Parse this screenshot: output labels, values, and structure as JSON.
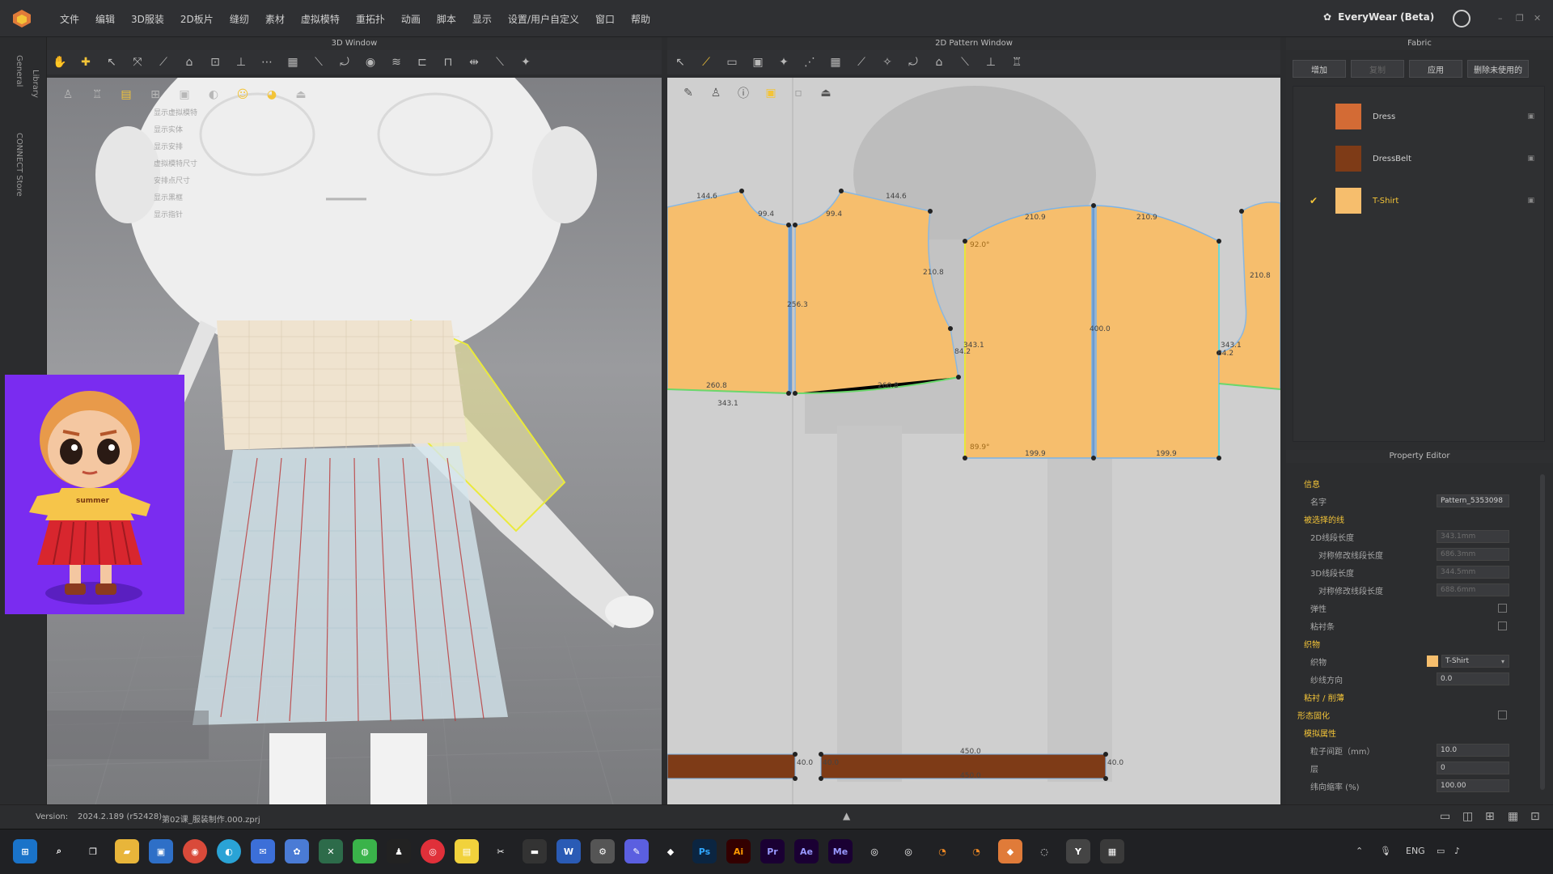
{
  "menu": [
    "文件",
    "编辑",
    "3D服装",
    "2D板片",
    "缝纫",
    "素材",
    "虚拟模特",
    "重拓扑",
    "动画",
    "脚本",
    "显示",
    "设置/用户自定义",
    "窗口",
    "帮助"
  ],
  "brand": "EveryWear (Beta)",
  "left_tabs": [
    "Library",
    "General",
    "CONNECT Store"
  ],
  "windows": {
    "3d_title": "3D Window",
    "2d_title": "2D Pattern Window",
    "fabric_title": "Fabric",
    "property_title": "Property Editor"
  },
  "avatar_menu": [
    "显示虚拟模特",
    "显示实体",
    "显示安排",
    "虚拟模特尺寸",
    "安排点尺寸",
    "显示黑框",
    "显示指针"
  ],
  "preview_shirt_text": "summer",
  "fabric": {
    "buttons": [
      "增加",
      "复制",
      "应用",
      "删除未使用的"
    ],
    "items": [
      {
        "name": "Dress",
        "color": "#d36b35",
        "selected": false
      },
      {
        "name": "DressBelt",
        "color": "#7e3b17",
        "selected": false
      },
      {
        "name": "T-Shirt",
        "color": "#f6be6d",
        "selected": true
      }
    ]
  },
  "pattern_labels": {
    "seg1": "144.6",
    "seg2": "99.4",
    "seg3": "99.4",
    "seg4": "144.6",
    "seg5": "210.8",
    "seg6": "260.8",
    "seg7": "343.1",
    "seg8": "260.8",
    "seg9": "210.9",
    "seg10": "210.9",
    "seg11": "92.0°",
    "seg12": "89.9°",
    "seg13": "199.9",
    "seg14": "199.9",
    "seg15": "343.1",
    "seg16": "84.2",
    "seg17": "210.8",
    "seg18": "343.1",
    "seg19": "84.2",
    "seg20": "450.0",
    "seg21": "40.0",
    "seg22": "40.0",
    "seg23": "450.0",
    "seg24": "40.0",
    "seg25": "256.3",
    "seg26": "400.0"
  },
  "property": {
    "rows": [
      {
        "label": "信息",
        "type": "section"
      },
      {
        "label": "名字",
        "value": "Pattern_5353098",
        "type": "field"
      },
      {
        "label": "被选择的线",
        "type": "section"
      },
      {
        "label": "2D线段长度",
        "value": "343.1mm",
        "type": "dimfield"
      },
      {
        "label": "对称修改线段长度",
        "value": "686.3mm",
        "type": "dimfield",
        "sub": true
      },
      {
        "label": "3D线段长度",
        "value": "344.5mm",
        "type": "dimfield"
      },
      {
        "label": "对称修改线段长度",
        "value": "688.6mm",
        "type": "dimfield",
        "sub": true
      },
      {
        "label": "弹性",
        "type": "check"
      },
      {
        "label": "粘衬条",
        "type": "check"
      },
      {
        "label": "织物",
        "type": "section"
      },
      {
        "label": "织物",
        "value": "T-Shirt",
        "type": "fabric"
      },
      {
        "label": "纱线方向",
        "value": "0.0",
        "type": "field"
      },
      {
        "label": "粘衬 / 削薄",
        "type": "section"
      },
      {
        "label": "形态固化",
        "type": "check"
      },
      {
        "label": "模拟属性",
        "type": "section"
      },
      {
        "label": "粒子间距（mm）",
        "value": "10.0",
        "type": "field"
      },
      {
        "label": "层",
        "value": "0",
        "type": "field"
      },
      {
        "label": "纬向缩率 (%)",
        "value": "100.00",
        "type": "field"
      }
    ]
  },
  "status": {
    "version_label": "Version:",
    "version": "2024.2.189 (r52428)",
    "file": "第02课_服装制作.000.zprj"
  },
  "taskbar": {
    "apps": [
      "Ps",
      "Ai",
      "Pr",
      "Ae",
      "Me",
      "Y"
    ],
    "lang": "ENG"
  }
}
